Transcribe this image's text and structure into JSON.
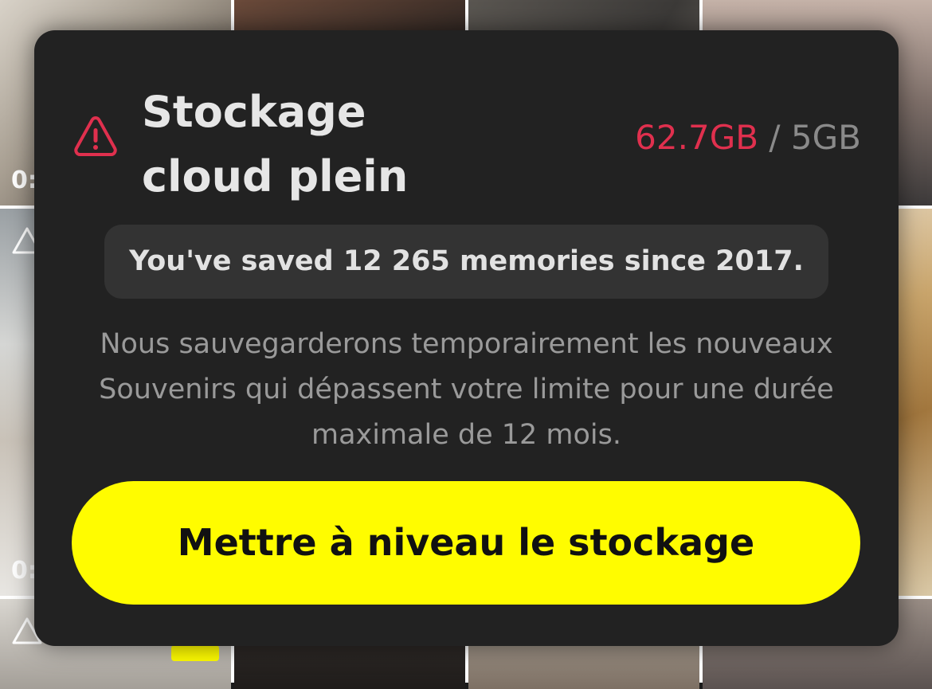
{
  "background": {
    "tiles": [
      {
        "duration": ""
      },
      {
        "duration": ""
      },
      {
        "duration": ""
      },
      {
        "duration": ""
      },
      {
        "duration": ""
      },
      {
        "duration": ""
      },
      {
        "duration": ""
      },
      {
        "duration": ""
      },
      {
        "duration": ""
      },
      {
        "duration": ""
      },
      {
        "duration": ""
      },
      {
        "duration": ""
      }
    ],
    "tile_label_left": "0:",
    "tile_label_left_2": "0:"
  },
  "modal": {
    "icon": "warning-triangle-icon",
    "title": "Stockage\ncloud plein",
    "usage": {
      "used": "62.7GB",
      "separator": " / ",
      "limit": "5GB"
    },
    "memories_summary": "You've saved 12 265 memories since 2017.",
    "description": "Nous sauvegarderons temporairement les nouveaux Souvenirs qui dépassent votre limite pour une durée maximale de 12 mois.",
    "upgrade_button": "Mettre à niveau le stockage"
  },
  "colors": {
    "accent_yellow": "#fffc00",
    "alert_red": "#e0304e",
    "modal_bg": "#222222"
  }
}
